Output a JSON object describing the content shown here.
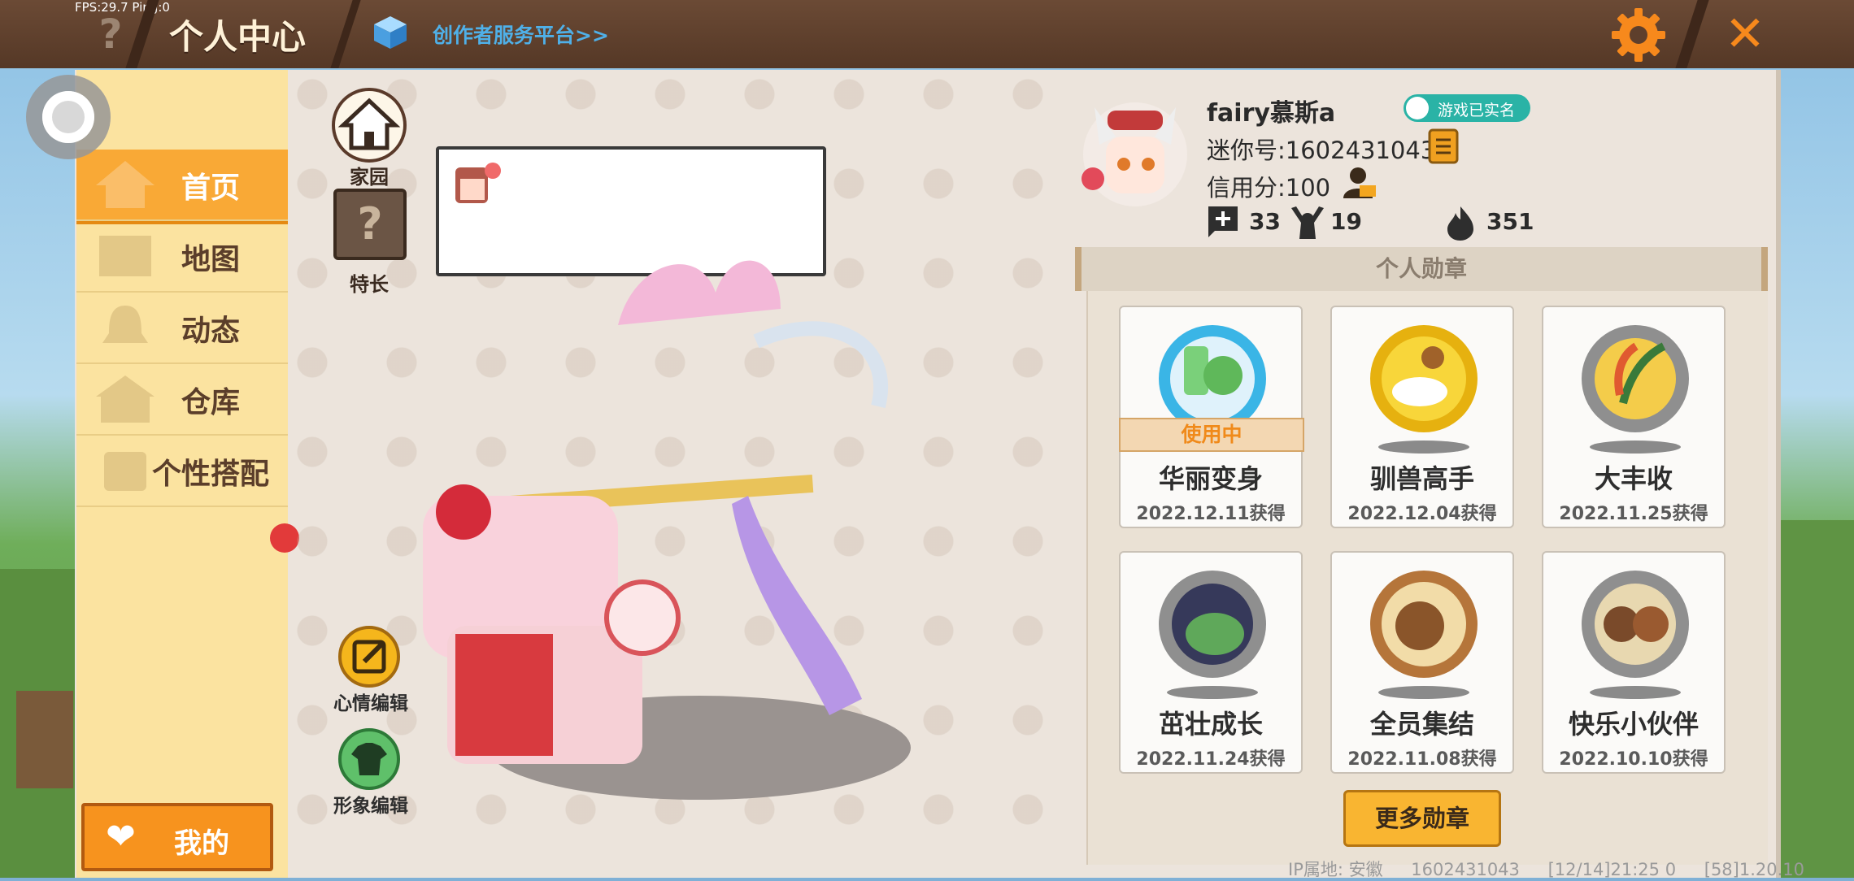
{
  "overlay": {
    "fps_text": "FPS:29.7  Ping:0"
  },
  "topbar": {
    "help_symbol": "?",
    "title": "个人中心",
    "creator_link": "创作者服务平台>>",
    "close_symbol": "✕"
  },
  "sidebar": {
    "items": [
      {
        "label": "首页",
        "active": true
      },
      {
        "label": "地图",
        "active": false
      },
      {
        "label": "动态",
        "active": false
      },
      {
        "label": "仓库",
        "active": false
      },
      {
        "label": "个性搭配",
        "active": false
      }
    ],
    "my_label": "我的"
  },
  "character_area": {
    "home_label": "家园",
    "skill_symbol": "?",
    "skill_label": "特长",
    "mood_edit_label": "心情编辑",
    "look_edit_label": "形象编辑"
  },
  "profile": {
    "username": "fairy慕斯a",
    "realname_badge": "游戏已实名",
    "mini_id": "迷你号:1602431043",
    "credit": "信用分:100",
    "stats": {
      "friends": "33",
      "fans": "19",
      "popularity": "351"
    }
  },
  "medals": {
    "header": "个人勋章",
    "in_use_label": "使用中",
    "items": [
      {
        "name": "华丽变身",
        "date": "2022.12.11获得",
        "in_use": true
      },
      {
        "name": "驯兽高手",
        "date": "2022.12.04获得",
        "in_use": false
      },
      {
        "name": "大丰收",
        "date": "2022.11.25获得",
        "in_use": false
      },
      {
        "name": "茁壮成长",
        "date": "2022.11.24获得",
        "in_use": false
      },
      {
        "name": "全员集结",
        "date": "2022.11.08获得",
        "in_use": false
      },
      {
        "name": "快乐小伙伴",
        "date": "2022.10.10获得",
        "in_use": false
      }
    ],
    "more_button": "更多勋章"
  },
  "footer": {
    "ip_location": "IP属地: 安徽",
    "uid": "1602431043",
    "time": "[12/14]21:25 0",
    "version": "[58]1.20.10"
  },
  "colors": {
    "topbar": "#5e3f2c",
    "sidebar": "#fbe3a0",
    "active_tab": "#f9a936",
    "accent_orange": "#f7931e",
    "creator_link": "#4fb0e8",
    "badge_teal": "#2ab3a6"
  }
}
